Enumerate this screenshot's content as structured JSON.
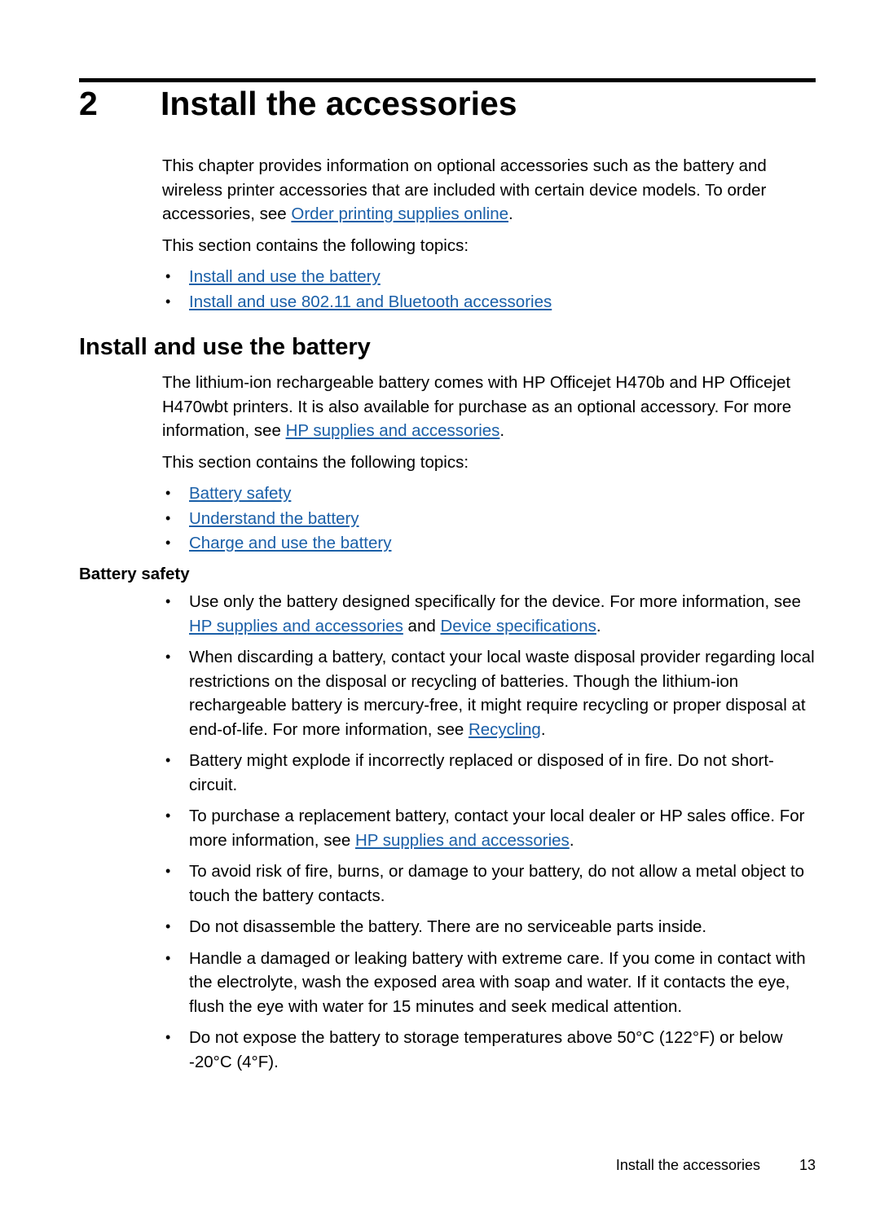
{
  "chapter": {
    "number": "2",
    "title": "Install the accessories"
  },
  "intro": {
    "paragraph_part1": "This chapter provides information on optional accessories such as the battery and wireless printer accessories that are included with certain device models. To order accessories, see ",
    "link1": "Order printing supplies online",
    "paragraph_part2": ".",
    "topics_lead": "This section contains the following topics:",
    "topics": [
      "Install and use the battery",
      "Install and use 802.11 and Bluetooth accessories"
    ]
  },
  "section_battery": {
    "heading": "Install and use the battery",
    "paragraph_part1": "The lithium-ion rechargeable battery comes with HP Officejet H470b and HP Officejet H470wbt printers. It is also available for purchase as an optional accessory. For more information, see ",
    "link1": "HP supplies and accessories",
    "paragraph_part2": ".",
    "topics_lead": "This section contains the following topics:",
    "topics": [
      "Battery safety",
      "Understand the battery",
      "Charge and use the battery"
    ]
  },
  "battery_safety": {
    "heading": "Battery safety",
    "items": [
      {
        "text_1": "Use only the battery designed specifically for the device. For more information, see ",
        "link_1": "HP supplies and accessories",
        "text_2": " and ",
        "link_2": "Device specifications",
        "text_3": "."
      },
      {
        "text_1": "When discarding a battery, contact your local waste disposal provider regarding local restrictions on the disposal or recycling of batteries. Though the lithium-ion rechargeable battery is mercury-free, it might require recycling or proper disposal at end-of-life. For more information, see ",
        "link_1": "Recycling",
        "text_2": "."
      },
      {
        "text_1": "Battery might explode if incorrectly replaced or disposed of in fire. Do not short-circuit."
      },
      {
        "text_1": "To purchase a replacement battery, contact your local dealer or HP sales office. For more information, see ",
        "link_1": "HP supplies and accessories",
        "text_2": "."
      },
      {
        "text_1": "To avoid risk of fire, burns, or damage to your battery, do not allow a metal object to touch the battery contacts."
      },
      {
        "text_1": "Do not disassemble the battery. There are no serviceable parts inside."
      },
      {
        "text_1": "Handle a damaged or leaking battery with extreme care. If you come in contact with the electrolyte, wash the exposed area with soap and water. If it contacts the eye, flush the eye with water for 15 minutes and seek medical attention."
      },
      {
        "text_1": "Do not expose the battery to storage temperatures above 50°C (122°F) or below -20°C (4°F)."
      }
    ]
  },
  "footer": {
    "title": "Install the accessories",
    "page_number": "13"
  },
  "colors": {
    "link": "#1a5fa8",
    "text": "#000000",
    "background": "#ffffff"
  }
}
